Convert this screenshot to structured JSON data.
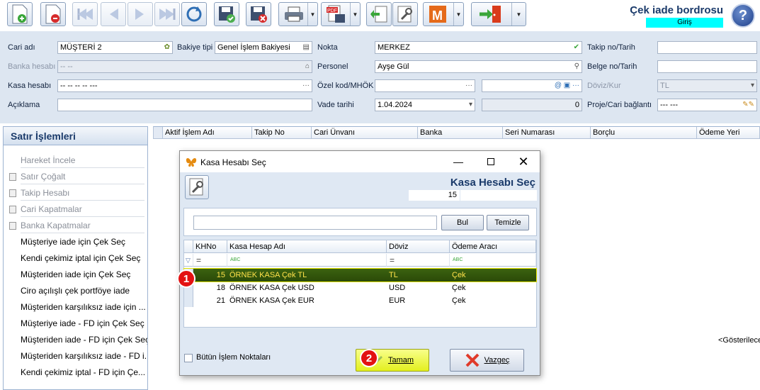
{
  "header": {
    "title": "Çek iade bordrosu",
    "subtitle": "Giriş",
    "help_icon": "?"
  },
  "form": {
    "cari_adi": {
      "label": "Cari adı",
      "value": "MÜŞTERİ 2"
    },
    "bakiye_tipi": {
      "label": "Bakiye tipi",
      "value": "Genel İşlem Bakiyesi"
    },
    "nokta": {
      "label": "Nokta",
      "value": "MERKEZ"
    },
    "takip_no": {
      "label": "Takip no/Tarih",
      "value": ""
    },
    "banka_hesabi": {
      "label": "Banka hesabı",
      "value": "-- --"
    },
    "personel": {
      "label": "Personel",
      "value": "Ayşe Gül"
    },
    "belge_no": {
      "label": "Belge no/Tarih",
      "value": ""
    },
    "kasa_hesabi": {
      "label": "Kasa hesabı",
      "value": "-- -- -- -- ---"
    },
    "ozel_kod": {
      "label": "Özel kod/MHÖK",
      "value": ""
    },
    "doviz_kur": {
      "label": "Döviz/Kur",
      "value": "TL"
    },
    "aciklama": {
      "label": "Açıklama",
      "value": ""
    },
    "vade_tarihi": {
      "label": "Vade tarihi",
      "value": "1.04.2024"
    },
    "tutar": {
      "value": "0"
    },
    "proje": {
      "label": "Proje/Cari bağlantı",
      "value": "--- ---"
    }
  },
  "left_panel": {
    "title": "Satır İşlemleri",
    "items": [
      {
        "label": "Hareket İncele",
        "dim": true
      },
      {
        "label": "Satır Çoğalt",
        "dim": true
      },
      {
        "label": "Takip Hesabı",
        "dim": true
      },
      {
        "label": "Cari Kapatmalar",
        "dim": true
      },
      {
        "label": "Banka Kapatmalar",
        "dim": true
      },
      {
        "label": "Müşteriye iade için Çek Seç",
        "dim": false
      },
      {
        "label": "Kendi çekimiz iptal için Çek Seç",
        "dim": false
      },
      {
        "label": "Müşteriden iade için Çek Seç",
        "dim": false
      },
      {
        "label": "Ciro açılışlı çek portföye iade",
        "dim": false
      },
      {
        "label": "Müşteriden karşılıksız iade için ...",
        "dim": false
      },
      {
        "label": "Müşteriye iade - FD için Çek Seç",
        "dim": false
      },
      {
        "label": "Müşteriden iade - FD için Çek Seç",
        "dim": false
      },
      {
        "label": "Müşteriden karşılıksız iade - FD i...",
        "dim": false
      },
      {
        "label": "Kendi çekimiz iptal - FD için Çe...",
        "dim": false
      }
    ]
  },
  "main_grid": {
    "columns": [
      "Aktif İşlem Adı",
      "Takip No",
      "Cari Ünvanı",
      "Banka",
      "Seri Numarası",
      "Borçlu",
      "Ödeme Yeri"
    ],
    "empty_text": "<Gösterilecek"
  },
  "dialog": {
    "window_title": "Kasa Hesabı Seç",
    "heading": "Kasa Hesabı Seç",
    "count": "15",
    "search_button": "Bul",
    "clear_button": "Temizle",
    "columns": [
      "KHNo",
      "Kasa Hesap Adı",
      "Döviz",
      "Ödeme Aracı"
    ],
    "filter_eq": "=",
    "filter_abc": "ABC",
    "rows": [
      {
        "no": "15",
        "name": "ÖRNEK KASA Çek TL",
        "doviz": "TL",
        "arac": "Çek",
        "selected": true
      },
      {
        "no": "18",
        "name": "ÖRNEK KASA Çek USD",
        "doviz": "USD",
        "arac": "Çek",
        "selected": false
      },
      {
        "no": "21",
        "name": "ÖRNEK KASA Çek EUR",
        "doviz": "EUR",
        "arac": "Çek",
        "selected": false
      }
    ],
    "checkbox_label": "Bütün İşlem Noktaları",
    "ok_button": "Tamam",
    "cancel_button": "Vazgeç"
  },
  "annotations": {
    "step1": "1",
    "step2": "2"
  }
}
